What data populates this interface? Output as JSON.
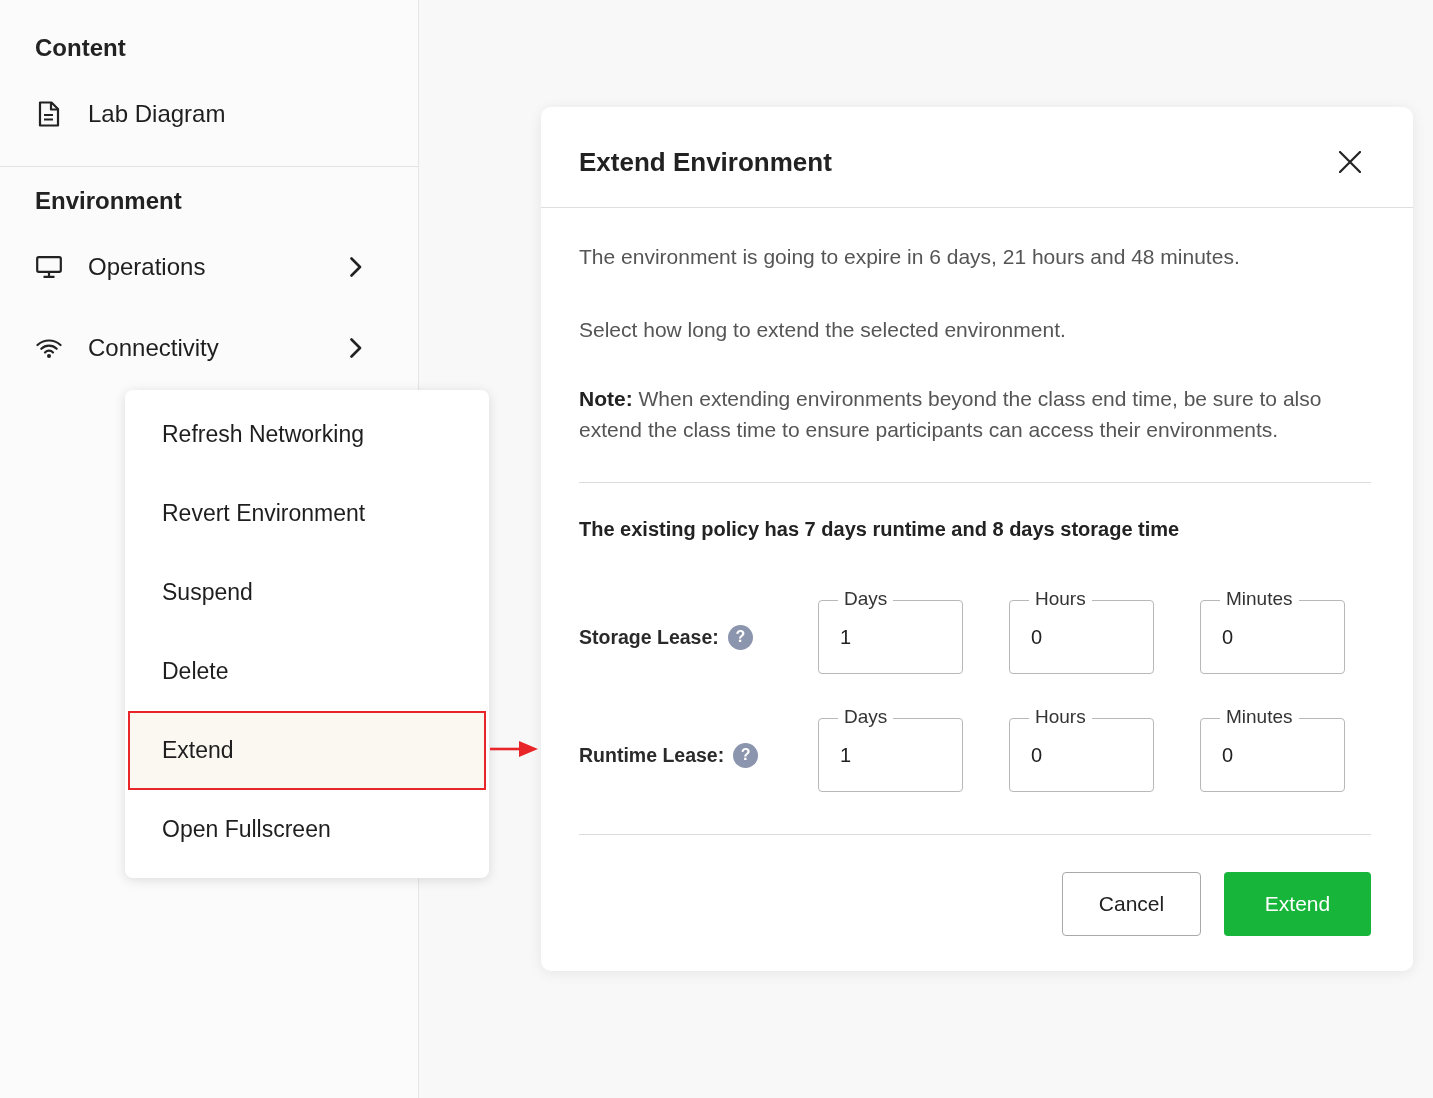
{
  "sidebar": {
    "sections": [
      {
        "heading": "Content",
        "items": [
          {
            "label": "Lab Diagram",
            "submenu": false
          }
        ]
      },
      {
        "heading": "Environment",
        "items": [
          {
            "label": "Operations",
            "submenu": true
          },
          {
            "label": "Connectivity",
            "submenu": true
          }
        ]
      }
    ]
  },
  "context_menu": {
    "items": [
      {
        "label": "Refresh Networking",
        "selected": false
      },
      {
        "label": "Revert Environment",
        "selected": false
      },
      {
        "label": "Suspend",
        "selected": false
      },
      {
        "label": "Delete",
        "selected": false
      },
      {
        "label": "Extend",
        "selected": true
      },
      {
        "label": "Open Fullscreen",
        "selected": false
      }
    ]
  },
  "dialog": {
    "title": "Extend Environment",
    "paragraphs": [
      "The environment is going to expire in 6 days, 21 hours and 48 minutes.",
      "Select how long to extend the selected environment.",
      "**Note:** When extending environments beyond the class end time, be sure to also extend the class time to ensure participants can access their environments."
    ],
    "policy": "The existing policy has 7 days runtime and 8 days storage time",
    "leases": [
      {
        "label": "Storage Lease:",
        "help": "?",
        "fields": [
          {
            "label": "Days",
            "value": "1"
          },
          {
            "label": "Hours",
            "value": "0"
          },
          {
            "label": "Minutes",
            "value": "0"
          }
        ]
      },
      {
        "label": "Runtime Lease:",
        "help": "?",
        "fields": [
          {
            "label": "Days",
            "value": "1"
          },
          {
            "label": "Hours",
            "value": "0"
          },
          {
            "label": "Minutes",
            "value": "0"
          }
        ]
      }
    ],
    "buttons": [
      {
        "label": "Cancel",
        "kind": "secondary"
      },
      {
        "label": "Extend",
        "kind": "primary"
      }
    ]
  }
}
